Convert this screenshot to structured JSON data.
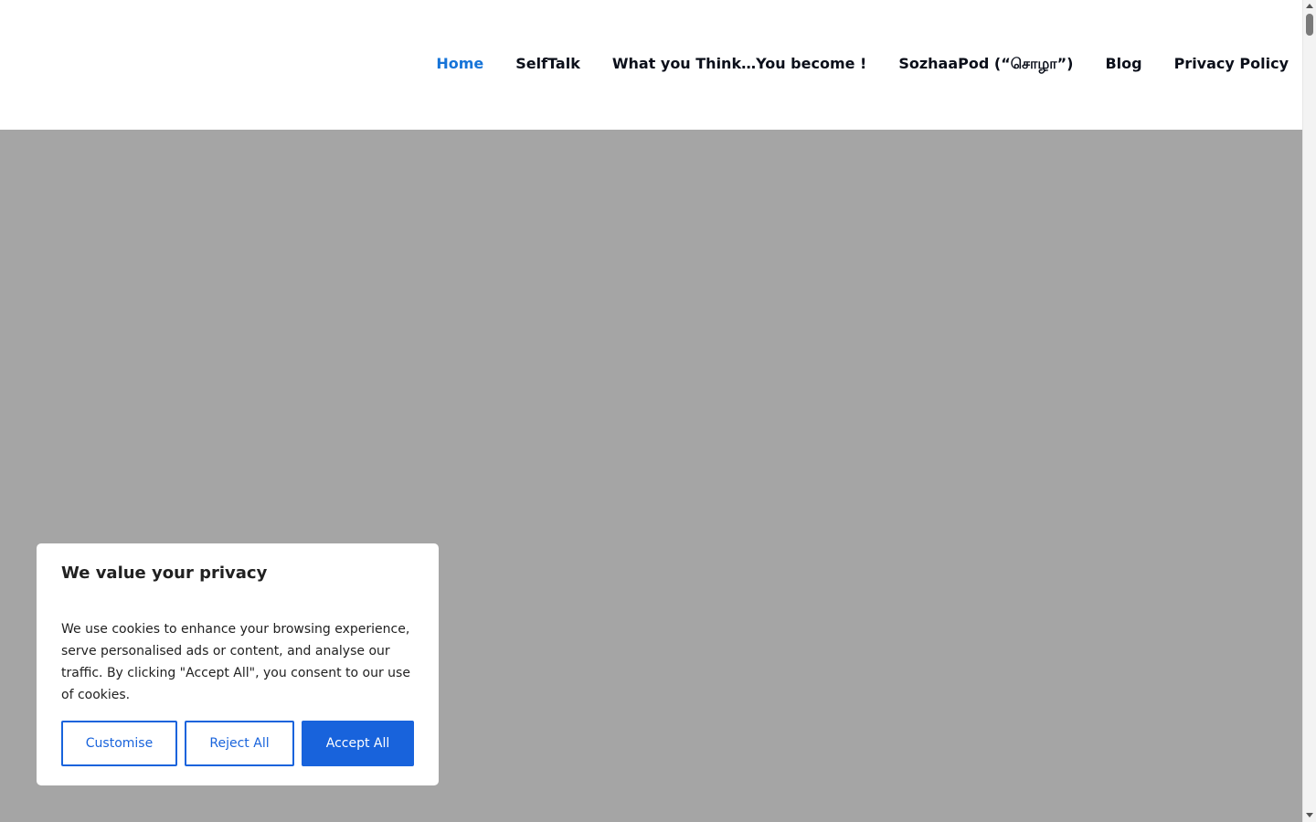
{
  "nav": {
    "items": [
      {
        "label": "Home",
        "active": true
      },
      {
        "label": "SelfTalk",
        "active": false
      },
      {
        "label": "What you Think…You become !",
        "active": false
      },
      {
        "label": "SozhaaPod (“சொழா”)",
        "active": false
      },
      {
        "label": "Blog",
        "active": false
      },
      {
        "label": "Privacy Policy",
        "active": false
      }
    ]
  },
  "cookie_banner": {
    "title": "We value your privacy",
    "text": "We use cookies to enhance your browsing experience, serve personalised ads or content, and analyse our traffic. By clicking \"Accept All\", you consent to our use of cookies.",
    "customise_label": "Customise",
    "reject_label": "Reject All",
    "accept_label": "Accept All"
  },
  "colors": {
    "nav_active": "#1674d8",
    "nav_text": "#0b0f1a",
    "hero_bg": "#a5a5a5",
    "button_primary": "#1863dc"
  }
}
